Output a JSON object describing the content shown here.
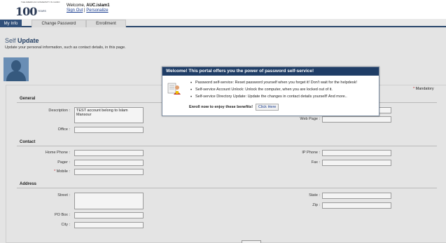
{
  "header": {
    "logo_university": "THE AMERICAN UNIVERSITY IN CAIRO",
    "logo_number": "100",
    "logo_years": "YEARS",
    "welcome_prefix": "Welcome,",
    "username": "AUC.islam1",
    "signout_label": "Sign Out",
    "separator": "|",
    "personalize_label": "Personalize"
  },
  "tabs": [
    {
      "label": "My Info",
      "active": true
    },
    {
      "label": "Change Password",
      "active": false
    },
    {
      "label": "Enrollment",
      "active": false
    }
  ],
  "page": {
    "title_prefix": "Self",
    "title_bold": "Update",
    "subtitle": "Update your personal information, such as contact details, in this page.",
    "mandatory_label": "Mandatory",
    "mandatory_star": "*"
  },
  "sections": {
    "general": "General",
    "contact": "Contact",
    "address": "Address"
  },
  "fields": {
    "description_label": "Description :",
    "description_value": "TEST account belong to Islam Mansour",
    "office_label": "Office :",
    "web_page_label": "Web Page :",
    "home_phone_label": "Home Phone :",
    "pager_label": "Pager :",
    "mobile_label": "Mobile :",
    "ip_phone_label": "IP Phone :",
    "fax_label": "Fax :",
    "street_label": "Street :",
    "po_box_label": "PO Box :",
    "city_label": "City :",
    "state_label": "State :",
    "zip_label": "Zip :"
  },
  "modal": {
    "title": "Welcome! This portal offers you the power of password self-service!",
    "bullets": [
      "Password self-service: Reset password yourself when you forget it! Don't wait for the helpdesk!",
      "Self-service Account Unlock: Unlock the computer, when you are locked out of it.",
      "Self-service Directory Update: Update the changes in contact details yourself! And more.."
    ],
    "enroll_text": "Enroll now to enjoy these benefits!",
    "click_label": "Click Here"
  },
  "colors": {
    "tab_active": "#31507a",
    "modal_header": "#1f3d66",
    "title": "#1e3a5f",
    "required": "#c0272d"
  }
}
